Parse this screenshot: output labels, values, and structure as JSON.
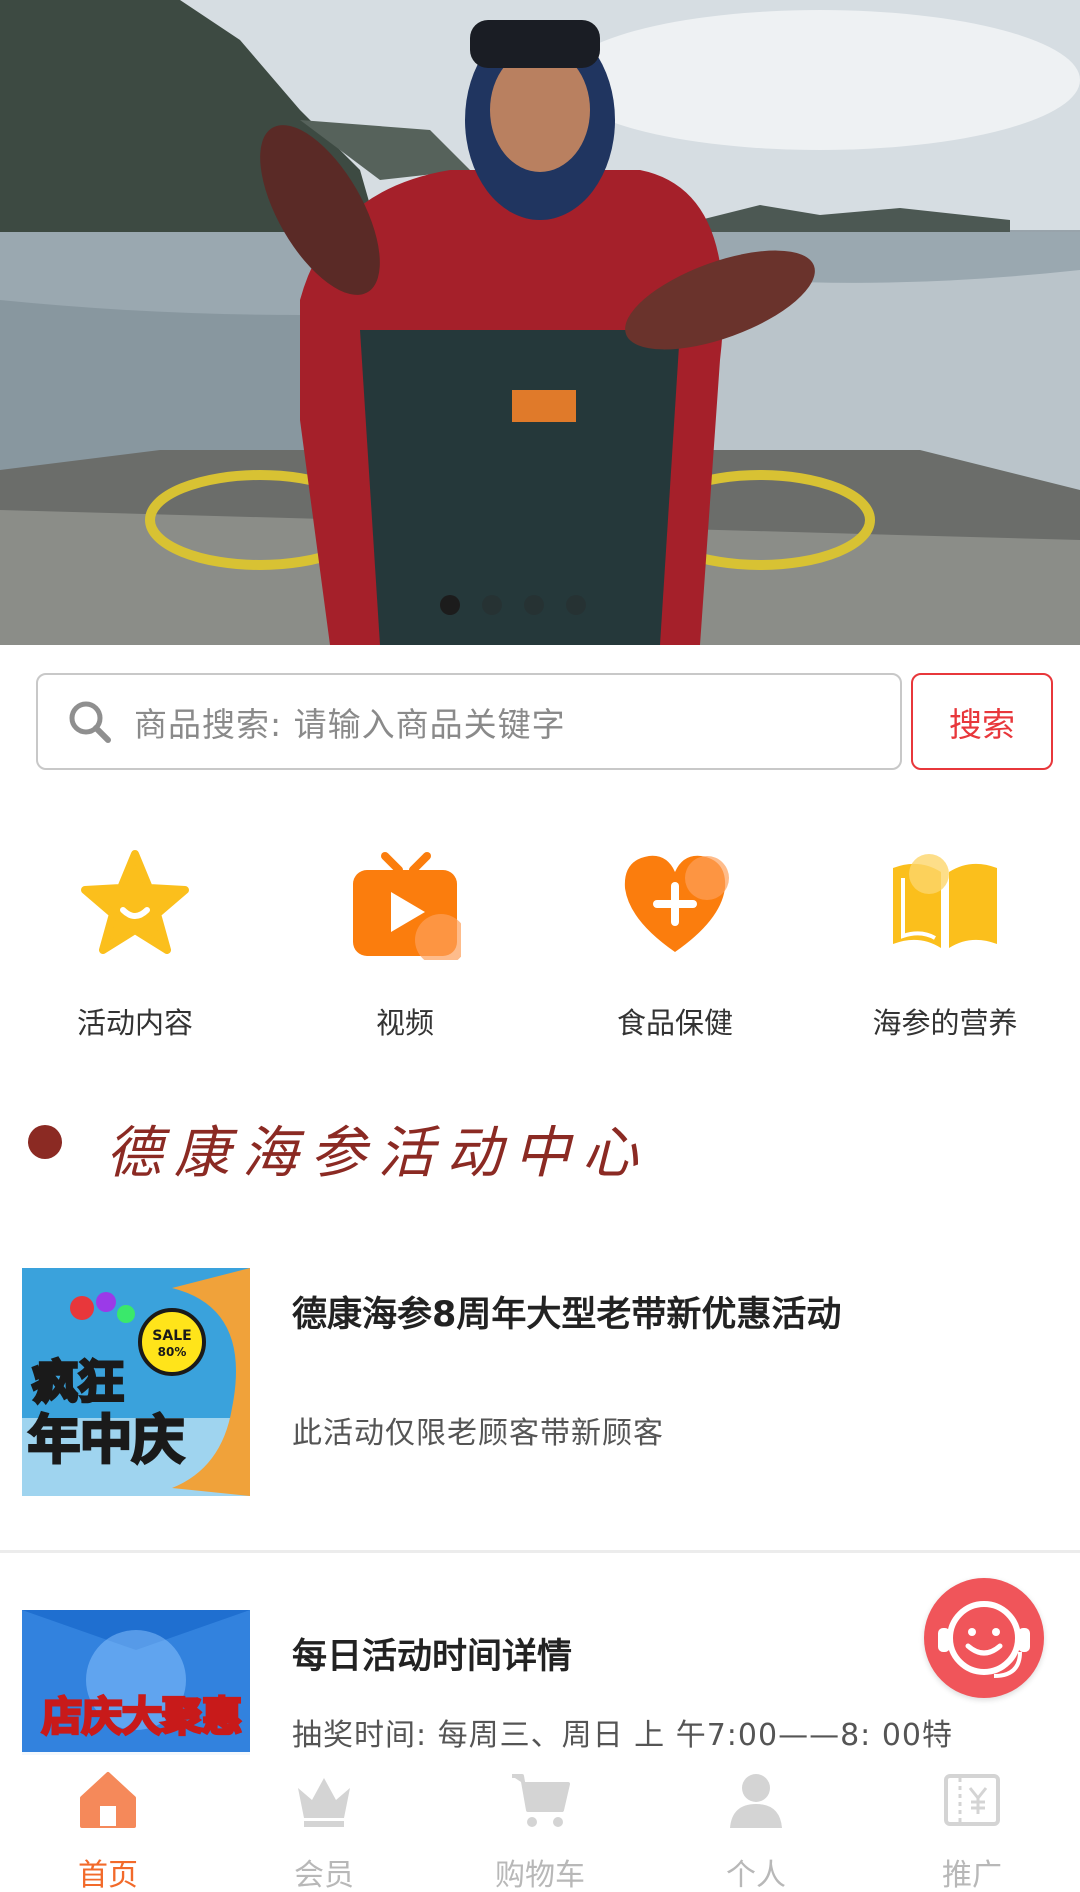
{
  "banner": {
    "slide_count": 4,
    "active_slide": 1
  },
  "search": {
    "placeholder": "商品搜索: 请输入商品关键字",
    "button_label": "搜索"
  },
  "quick_menu": [
    {
      "label": "活动内容",
      "icon": "star-smile-icon",
      "color": "#fbbf1c"
    },
    {
      "label": "视频",
      "icon": "tv-play-icon",
      "color": "#fb7d0d"
    },
    {
      "label": "食品保健",
      "icon": "heart-plus-icon",
      "color": "#fb7d0d"
    },
    {
      "label": "海参的营养",
      "icon": "open-book-icon",
      "color": "#fbbf1c"
    }
  ],
  "section": {
    "title": "德康海参活动中心",
    "color": "#8b2a23"
  },
  "activities": [
    {
      "title": "德康海参8周年大型老带新优惠活动",
      "desc": "此活动仅限老顾客带新顾客",
      "thumb_text": "疯狂年中庆",
      "thumb_badge": "SALE 80%"
    },
    {
      "title": "每日活动时间详情",
      "desc": "抽奖时间: 每周三、周日 上 午7:00——8: 00特",
      "thumb_text": "店庆大聚惠"
    }
  ],
  "tabbar": {
    "active_color": "#f26a2a",
    "inactive_color": "#b8b8b8",
    "items": [
      {
        "label": "首页",
        "icon": "home-icon",
        "active": true
      },
      {
        "label": "会员",
        "icon": "crown-icon",
        "active": false
      },
      {
        "label": "购物车",
        "icon": "cart-icon",
        "active": false
      },
      {
        "label": "个人",
        "icon": "person-icon",
        "active": false
      },
      {
        "label": "推广",
        "icon": "yen-ticket-icon",
        "active": false
      }
    ]
  }
}
